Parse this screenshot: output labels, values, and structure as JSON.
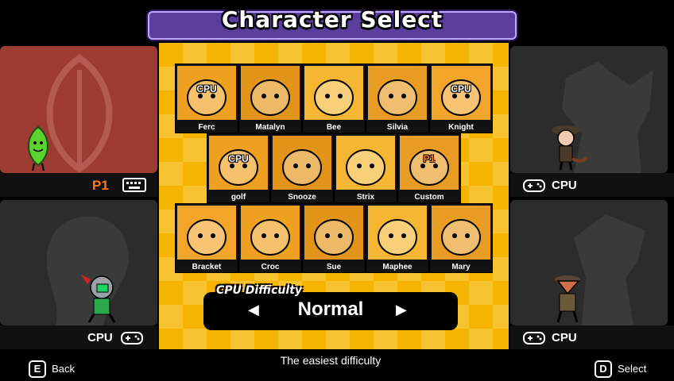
{
  "title": "Character Select",
  "panels": {
    "top_left": {
      "label": "P1",
      "input_icon": "keyboard-icon",
      "bg": "#9c3b32"
    },
    "top_right": {
      "label": "CPU",
      "input_icon": "gamepad-icon",
      "bg": "#2a2a2a"
    },
    "bottom_left": {
      "label": "CPU",
      "input_icon": "gamepad-icon",
      "bg": "#2a2a2a"
    },
    "bottom_right": {
      "label": "CPU",
      "input_icon": "gamepad-icon",
      "bg": "#2a2a2a"
    }
  },
  "roster": [
    {
      "name": "Ferc",
      "tag": "CPU"
    },
    {
      "name": "Matalyn",
      "tag": ""
    },
    {
      "name": "Bee",
      "tag": ""
    },
    {
      "name": "Silvia",
      "tag": ""
    },
    {
      "name": "Knight",
      "tag": "CPU"
    },
    {
      "name": "golf",
      "tag": "CPU"
    },
    {
      "name": "Snooze",
      "tag": ""
    },
    {
      "name": "Strix",
      "tag": ""
    },
    {
      "name": "Custom",
      "tag": "P1"
    },
    {
      "name": "Bracket",
      "tag": ""
    },
    {
      "name": "Croc",
      "tag": ""
    },
    {
      "name": "Sue",
      "tag": ""
    },
    {
      "name": "Maphee",
      "tag": ""
    },
    {
      "name": "Mary",
      "tag": ""
    }
  ],
  "difficulty": {
    "label": "CPU Difficulty",
    "value": "Normal",
    "description": "The easiest difficulty"
  },
  "hints": {
    "back": {
      "key": "E",
      "label": "Back"
    },
    "select": {
      "key": "D",
      "label": "Select"
    }
  },
  "colors": {
    "p1": "#ff7a1a",
    "accent": "#5b3d9e"
  }
}
